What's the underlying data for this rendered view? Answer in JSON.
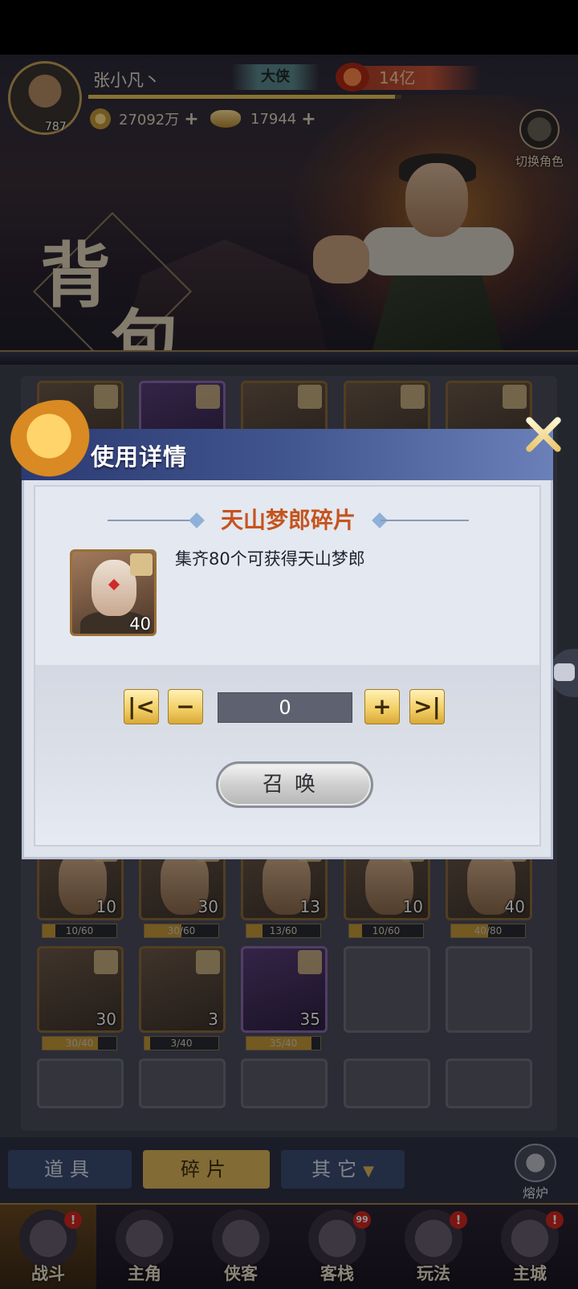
{
  "header": {
    "player_name": "张小凡丶",
    "level": "787",
    "rank": "大侠",
    "power": "14亿",
    "exp_ratio": 0.98,
    "copper": "27092万",
    "gold": "17944",
    "switch_role_label": "切换角色",
    "page_title_chars": [
      "背",
      "包"
    ]
  },
  "inventory": {
    "row_top_hidden_count": 5,
    "hero_row": [
      {
        "count": "10",
        "progress": "10/60",
        "ratio": 0.17
      },
      {
        "count": "30",
        "progress": "30/60",
        "ratio": 0.5
      },
      {
        "count": "13",
        "progress": "13/60",
        "ratio": 0.22
      },
      {
        "count": "10",
        "progress": "10/60",
        "ratio": 0.17
      },
      {
        "count": "40",
        "progress": "40/80",
        "ratio": 0.5
      }
    ],
    "item_row": [
      {
        "count": "30",
        "progress": "30/40",
        "ratio": 0.75
      },
      {
        "count": "3",
        "progress": "3/40",
        "ratio": 0.08
      },
      {
        "count": "35",
        "progress": "35/40",
        "ratio": 0.88
      }
    ]
  },
  "tabs": {
    "items": "道具",
    "fragments": "碎片",
    "others": "其它",
    "furnace": "熔炉"
  },
  "bottom_nav": [
    {
      "label": "战斗",
      "badge": "!"
    },
    {
      "label": "主角",
      "badge": ""
    },
    {
      "label": "侠客",
      "badge": ""
    },
    {
      "label": "客栈",
      "badge": "99"
    },
    {
      "label": "玩法",
      "badge": "!"
    },
    {
      "label": "主城",
      "badge": "!"
    }
  ],
  "dialog": {
    "title": "使用详情",
    "item_name": "天山梦郎碎片",
    "item_count": "40",
    "description": "集齐80个可获得天山梦郎",
    "quantity": "0",
    "summon_label": "召唤",
    "btn_first": "|<",
    "btn_minus": "−",
    "btn_plus": "+",
    "btn_last": ">|"
  },
  "colors": {
    "accent_gold": "#e0b85a",
    "dialog_header": "#41558e",
    "item_name": "#c5541e"
  }
}
